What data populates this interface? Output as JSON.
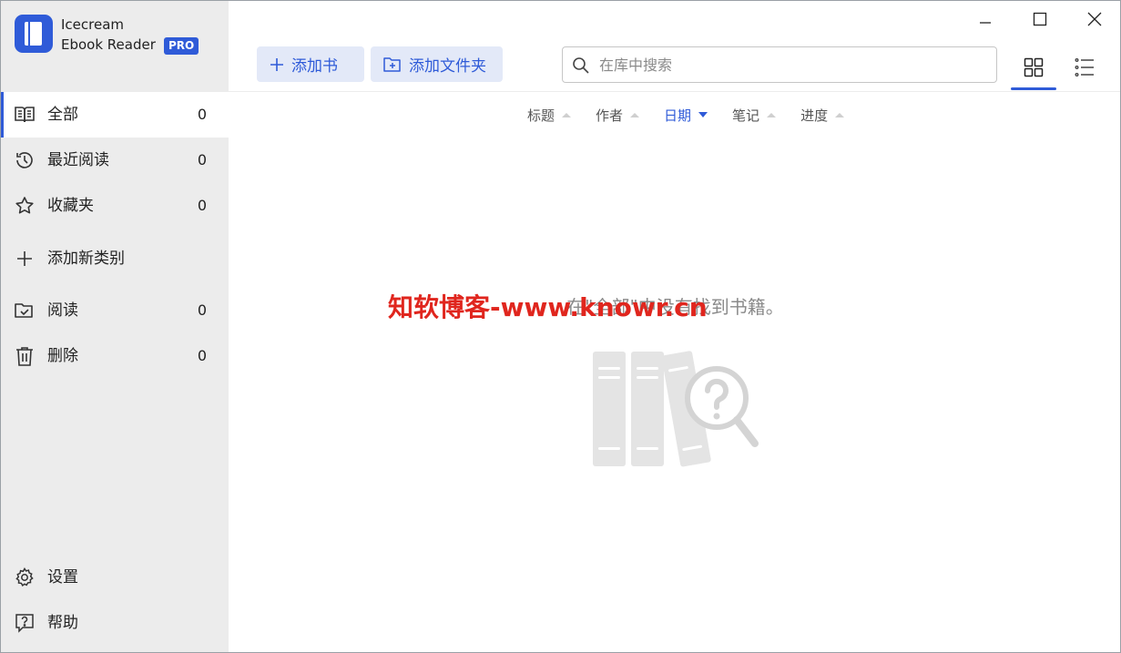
{
  "app": {
    "name_line1": "Icecream",
    "name_line2": "Ebook Reader",
    "badge": "PRO",
    "accent_color": "#2f5bd8"
  },
  "sidebar": {
    "items": [
      {
        "label": "全部",
        "count": "0",
        "icon": "book-open-icon",
        "active": true
      },
      {
        "label": "最近阅读",
        "count": "0",
        "icon": "history-icon"
      },
      {
        "label": "收藏夹",
        "count": "0",
        "icon": "star-icon"
      },
      {
        "label": "添加新类别",
        "icon": "plus-icon"
      },
      {
        "label": "阅读",
        "count": "0",
        "icon": "folder-check-icon"
      },
      {
        "label": "删除",
        "count": "0",
        "icon": "trash-icon"
      }
    ],
    "footer": [
      {
        "label": "设置",
        "icon": "gear-icon"
      },
      {
        "label": "帮助",
        "icon": "help-icon"
      }
    ]
  },
  "toolbar": {
    "add_book": "添加书",
    "add_folder": "添加文件夹",
    "search_placeholder": "在库中搜索"
  },
  "sort": {
    "columns": [
      {
        "label": "标题"
      },
      {
        "label": "作者"
      },
      {
        "label": "日期",
        "active": true
      },
      {
        "label": "笔记"
      },
      {
        "label": "进度"
      }
    ]
  },
  "content": {
    "empty_message": "在\"全部\"中没有找到书籍。",
    "watermark": "知软博客-www.knowr.cn"
  }
}
